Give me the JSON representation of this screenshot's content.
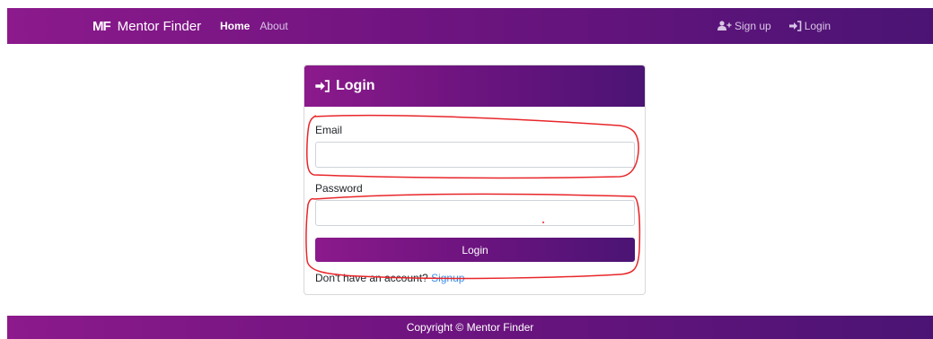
{
  "brand": {
    "logo": "MF",
    "name": "Mentor Finder"
  },
  "nav": {
    "home": "Home",
    "about": "About",
    "signup": "Sign up",
    "login": "Login",
    "signup_icon": "user-plus-icon",
    "login_icon": "sign-in-icon"
  },
  "card": {
    "title": "Login",
    "title_icon": "sign-in-icon",
    "email_label": "Email",
    "email_value": "",
    "password_label": "Password",
    "password_value": "",
    "button": "Login",
    "no_account": "Don't have an account?",
    "signup_link": "Signup"
  },
  "footer": {
    "text": "Copyright © Mentor Finder"
  },
  "colors": {
    "gradient_start": "#8c1a8c",
    "gradient_end": "#4b1474",
    "link": "#3b8ee8",
    "annotation": "#e8262a"
  }
}
